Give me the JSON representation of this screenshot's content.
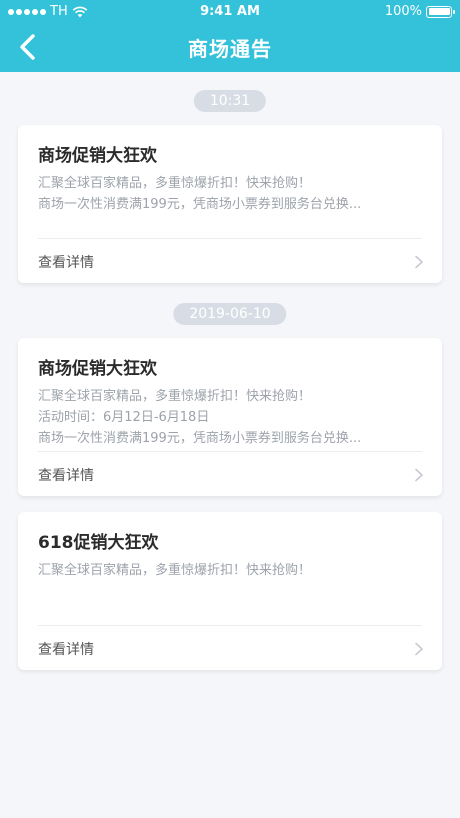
{
  "status": {
    "carrier": "TH",
    "time": "9:41 AM",
    "battery": "100%"
  },
  "nav": {
    "title": "商场通告"
  },
  "groups": [
    {
      "time": "10:31",
      "cards": [
        {
          "title": "商场促销大狂欢",
          "lines": [
            "汇聚全球百家精品，多重惊爆折扣！快来抢购！",
            "商场一次性消费满199元，凭商场小票券到服务台兑换..."
          ],
          "footer": "查看详情"
        }
      ]
    },
    {
      "time": "2019-06-10",
      "cards": [
        {
          "title": "商场促销大狂欢",
          "lines": [
            "汇聚全球百家精品，多重惊爆折扣！快来抢购！",
            "活动时间：6月12日-6月18日",
            "商场一次性消费满199元，凭商场小票券到服务台兑换..."
          ],
          "footer": "查看详情"
        },
        {
          "title": "618促销大狂欢",
          "lines": [
            "汇聚全球百家精品，多重惊爆折扣！快来抢购！"
          ],
          "footer": "查看详情"
        }
      ]
    }
  ]
}
